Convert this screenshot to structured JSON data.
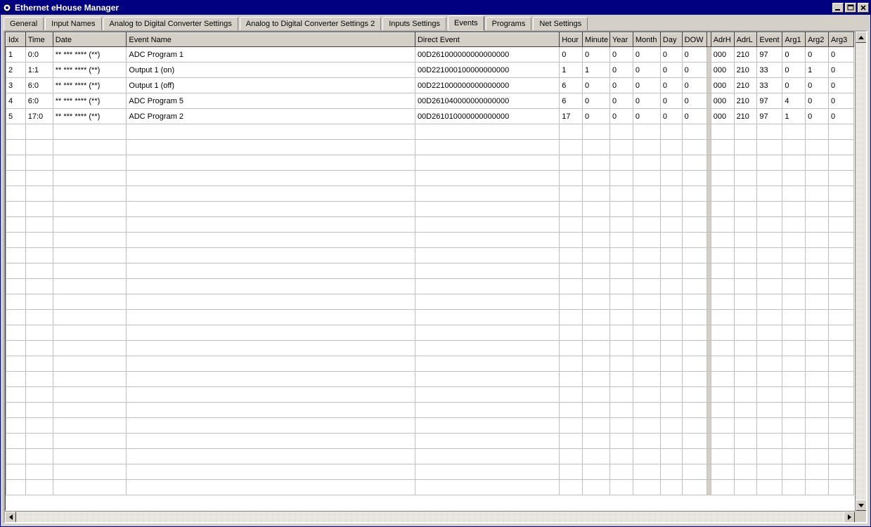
{
  "window": {
    "title": "Ethernet eHouse Manager"
  },
  "tabs": [
    {
      "label": "General"
    },
    {
      "label": "Input Names"
    },
    {
      "label": "Analog to Digital Converter Settings"
    },
    {
      "label": "Analog to Digital Converter Settings 2"
    },
    {
      "label": "Inputs Settings"
    },
    {
      "label": "Events",
      "active": true
    },
    {
      "label": "Programs"
    },
    {
      "label": "Net Settings"
    }
  ],
  "grid": {
    "headers": {
      "idx": "Idx",
      "time": "Time",
      "date": "Date",
      "event_name": "Event Name",
      "direct_event": "Direct Event",
      "hour": "Hour",
      "minute": "Minute",
      "year": "Year",
      "month": "Month",
      "day": "Day",
      "dow": "DOW",
      "adrh": "AdrH",
      "adrl": "AdrL",
      "event": "Event",
      "arg1": "Arg1",
      "arg2": "Arg2",
      "arg3": "Arg3"
    },
    "rows": [
      {
        "idx": "1",
        "time": "0:0",
        "date": "** *** **** (**)",
        "event_name": "ADC Program 1",
        "direct_event": "00D261000000000000000",
        "hour": "0",
        "minute": "0",
        "year": "0",
        "month": "0",
        "day": "0",
        "dow": "0",
        "adrh": "000",
        "adrl": "210",
        "event": "97",
        "arg1": "0",
        "arg2": "0",
        "arg3": "0"
      },
      {
        "idx": "2",
        "time": "1:1",
        "date": "** *** **** (**)",
        "event_name": "Output 1 (on)",
        "direct_event": "00D221000100000000000",
        "hour": "1",
        "minute": "1",
        "year": "0",
        "month": "0",
        "day": "0",
        "dow": "0",
        "adrh": "000",
        "adrl": "210",
        "event": "33",
        "arg1": "0",
        "arg2": "1",
        "arg3": "0"
      },
      {
        "idx": "3",
        "time": "6:0",
        "date": "** *** **** (**)",
        "event_name": "Output 1 (off)",
        "direct_event": "00D221000000000000000",
        "hour": "6",
        "minute": "0",
        "year": "0",
        "month": "0",
        "day": "0",
        "dow": "0",
        "adrh": "000",
        "adrl": "210",
        "event": "33",
        "arg1": "0",
        "arg2": "0",
        "arg3": "0"
      },
      {
        "idx": "4",
        "time": "6:0",
        "date": "** *** **** (**)",
        "event_name": "ADC Program 5",
        "direct_event": "00D261040000000000000",
        "hour": "6",
        "minute": "0",
        "year": "0",
        "month": "0",
        "day": "0",
        "dow": "0",
        "adrh": "000",
        "adrl": "210",
        "event": "97",
        "arg1": "4",
        "arg2": "0",
        "arg3": "0"
      },
      {
        "idx": "5",
        "time": "17:0",
        "date": "** *** **** (**)",
        "event_name": "ADC Program 2",
        "direct_event": "00D261010000000000000",
        "hour": "17",
        "minute": "0",
        "year": "0",
        "month": "0",
        "day": "0",
        "dow": "0",
        "adrh": "000",
        "adrl": "210",
        "event": "97",
        "arg1": "1",
        "arg2": "0",
        "arg3": "0"
      }
    ],
    "empty_rows": 24,
    "focused": {
      "row": 4,
      "col": "event_name"
    }
  }
}
